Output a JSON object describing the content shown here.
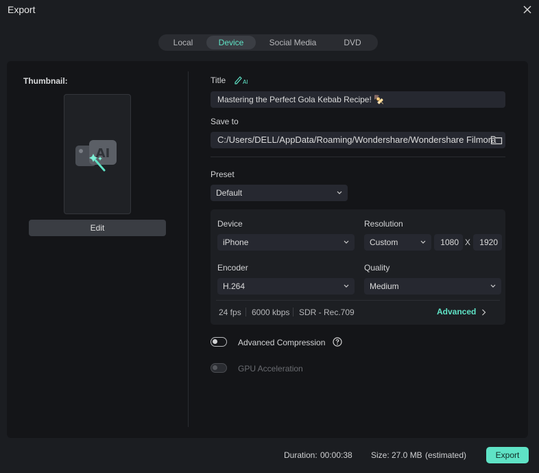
{
  "window": {
    "title": "Export"
  },
  "tabs": [
    {
      "label": "Local"
    },
    {
      "label": "Device",
      "active": true
    },
    {
      "label": "Social Media"
    },
    {
      "label": "DVD"
    }
  ],
  "thumbnail": {
    "label": "Thumbnail:",
    "edit_label": "Edit"
  },
  "form": {
    "title_label": "Title",
    "title_value": "Mastering the Perfect Gola Kebab Recipe! 🍢",
    "save_to_label": "Save to",
    "save_to_value": "C:/Users/DELL/AppData/Roaming/Wondershare/Wondershare Filmora",
    "preset_label": "Preset",
    "preset_value": "Default"
  },
  "settings": {
    "device_label": "Device",
    "device_value": "iPhone",
    "resolution_label": "Resolution",
    "resolution_value": "Custom",
    "width": "1080",
    "x": "X",
    "height": "1920",
    "encoder_label": "Encoder",
    "encoder_value": "H.264",
    "quality_label": "Quality",
    "quality_value": "Medium",
    "fps": "24 fps",
    "bitrate": "6000 kbps",
    "color": "SDR - Rec.709",
    "advanced_label": "Advanced"
  },
  "options": {
    "advanced_compression": {
      "label": "Advanced Compression",
      "on": false
    },
    "gpu_acceleration": {
      "label": "GPU Acceleration",
      "on": false,
      "disabled": true
    }
  },
  "footer": {
    "duration_label": "Duration:",
    "duration_value": "00:00:38",
    "size_label": "Size:",
    "size_value": "27.0 MB",
    "size_note": "(estimated)",
    "export_label": "Export"
  },
  "colors": {
    "accent": "#5fe3c6",
    "background": "#1b1d21",
    "panel": "#141518"
  }
}
